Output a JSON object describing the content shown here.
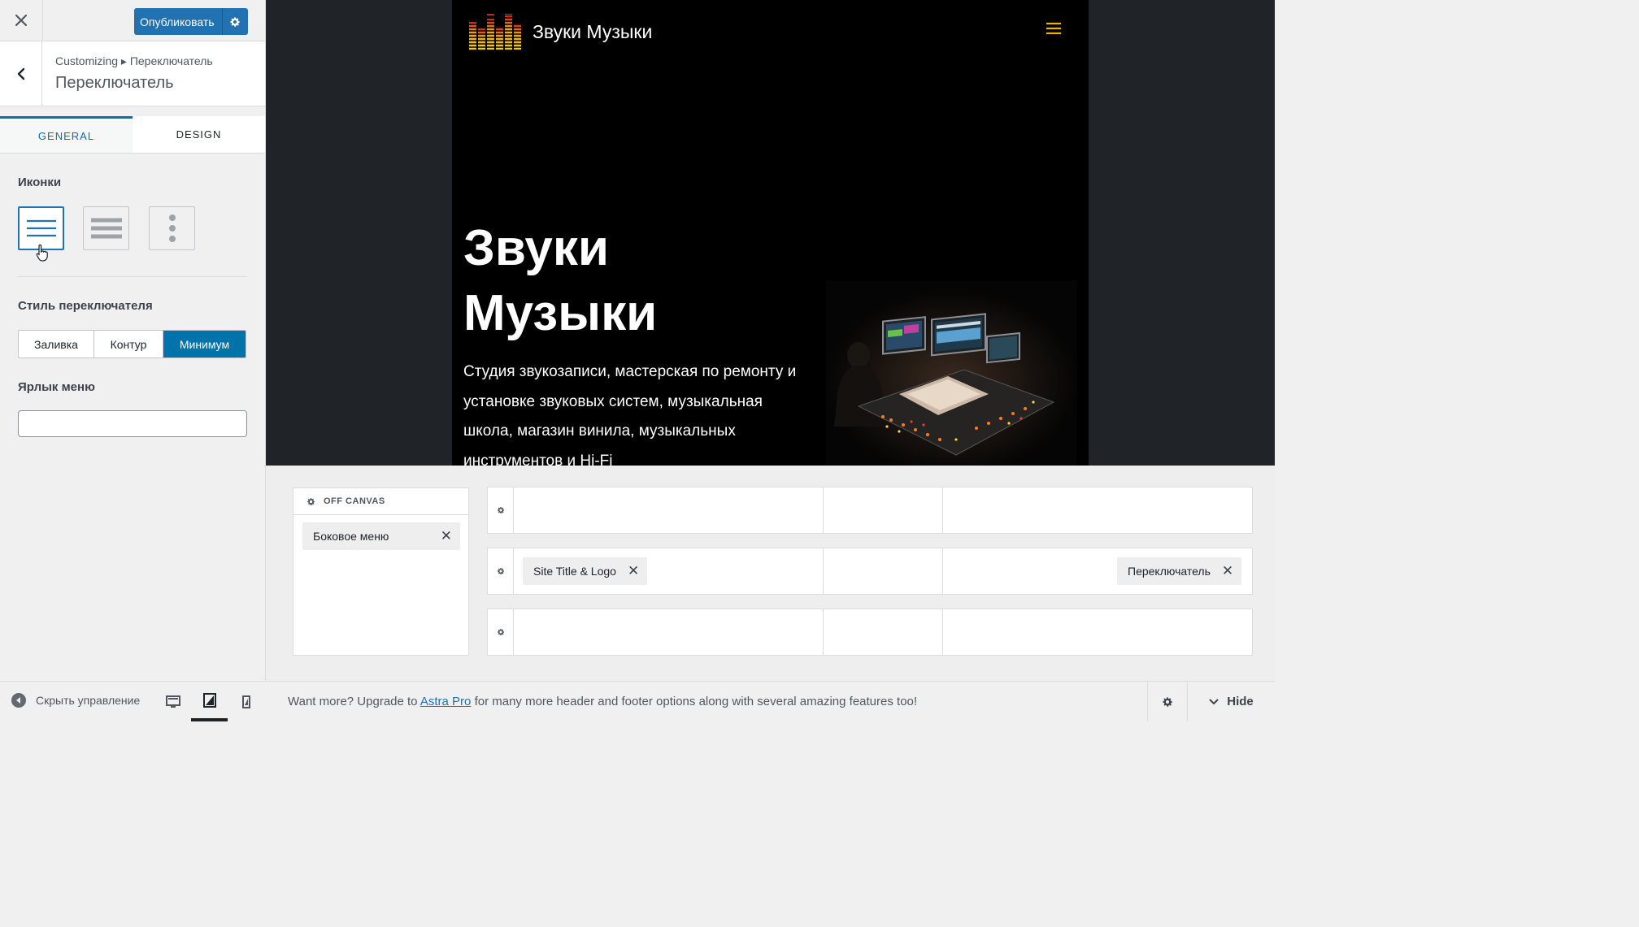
{
  "sidebar": {
    "publish_label": "Опубликовать",
    "breadcrumb": "Customizing ▸ Переключатель",
    "section_title": "Переключатель",
    "tabs": [
      {
        "label": "GENERAL",
        "active": true
      },
      {
        "label": "DESIGN",
        "active": false
      }
    ],
    "icons_label": "Иконки",
    "icon_options": [
      {
        "name": "menu-icon",
        "selected": true
      },
      {
        "name": "menu2-icon",
        "selected": false
      },
      {
        "name": "menu3-icon",
        "selected": false
      }
    ],
    "toggle_style_label": "Стиль переключателя",
    "toggle_styles": [
      {
        "label": "Заливка",
        "active": false
      },
      {
        "label": "Контур",
        "active": false
      },
      {
        "label": "Минимум",
        "active": true
      }
    ],
    "menu_label_label": "Ярлык меню",
    "menu_label_value": "",
    "collapse_label": "Скрыть управление"
  },
  "preview": {
    "site_title": "Звуки Музыки",
    "hero_title": "Звуки Музыки",
    "hero_text": "Студия звукозаписи, мастерская по ремонту и установке звуковых систем, музыкальная школа, магазин винила, музыкальных инструментов и Hi-Fi",
    "accent_color": "#e8b400"
  },
  "builder": {
    "offcanvas_title": "OFF CANVAS",
    "offcanvas_item": "Боковое меню",
    "row_middle_left_item": "Site Title & Logo",
    "row_middle_right_item": "Переключатель"
  },
  "footer": {
    "upsell_before": "Want more? Upgrade to ",
    "upsell_link": "Astra Pro",
    "upsell_after": " for many more header and footer options along with several amazing features too!",
    "hide_label": "Hide"
  },
  "colors": {
    "primary": "#2271b1",
    "tab_active": "#0073aa",
    "sidebar_bg": "#f0f0f1"
  }
}
